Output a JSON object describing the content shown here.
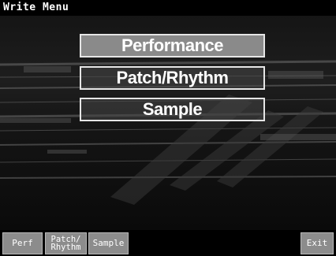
{
  "window": {
    "title": "Write Menu"
  },
  "menu": {
    "items": [
      {
        "label": "Performance"
      },
      {
        "label": "Patch/Rhythm"
      },
      {
        "label": "Sample"
      }
    ]
  },
  "function_keys": {
    "perf": "Perf",
    "patch_line1": "Patch/",
    "patch_line2": "Rhythm",
    "sample": "Sample",
    "exit": "Exit"
  },
  "colors": {
    "selected_button": "#8a8a8a",
    "border": "#e6e6e6",
    "background": "#141414"
  }
}
